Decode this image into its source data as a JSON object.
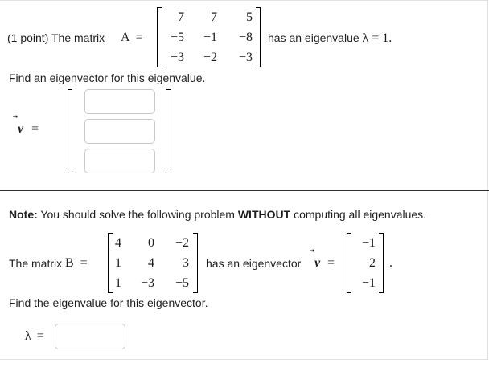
{
  "problem1": {
    "points": "(1 point)",
    "intro": "The matrix",
    "matrix_name": "A",
    "equals": "=",
    "matrix": [
      [
        "7",
        "7",
        "5"
      ],
      [
        "−5",
        "−1",
        "−8"
      ],
      [
        "−3",
        "−2",
        "−3"
      ]
    ],
    "has_eigenvalue_text": "has an eigenvalue",
    "lambda": "λ",
    "eigenvalue": "= 1.",
    "instruction": "Find an eigenvector for this eigenvalue.",
    "vector_symbol": "v",
    "vector_equals": "=",
    "inputs": [
      "",
      "",
      ""
    ]
  },
  "problem2": {
    "note_label": "Note:",
    "note_pre": "You should solve the following problem",
    "note_bold": "WITHOUT",
    "note_post": "computing all eigenvalues.",
    "intro": "The matrix",
    "matrix_name": "B",
    "equals": "=",
    "matrix": [
      [
        "4",
        "0",
        "−2"
      ],
      [
        "1",
        "4",
        "3"
      ],
      [
        "1",
        "−3",
        "−5"
      ]
    ],
    "has_eigenvector_text": "has an eigenvector",
    "vector_symbol": "v",
    "vector_equals": "=",
    "vector": [
      "−1",
      "2",
      "−1"
    ],
    "period": ".",
    "instruction": "Find the eigenvalue for this eigenvector.",
    "lambda": "λ",
    "lambda_equals": "=",
    "input": ""
  }
}
